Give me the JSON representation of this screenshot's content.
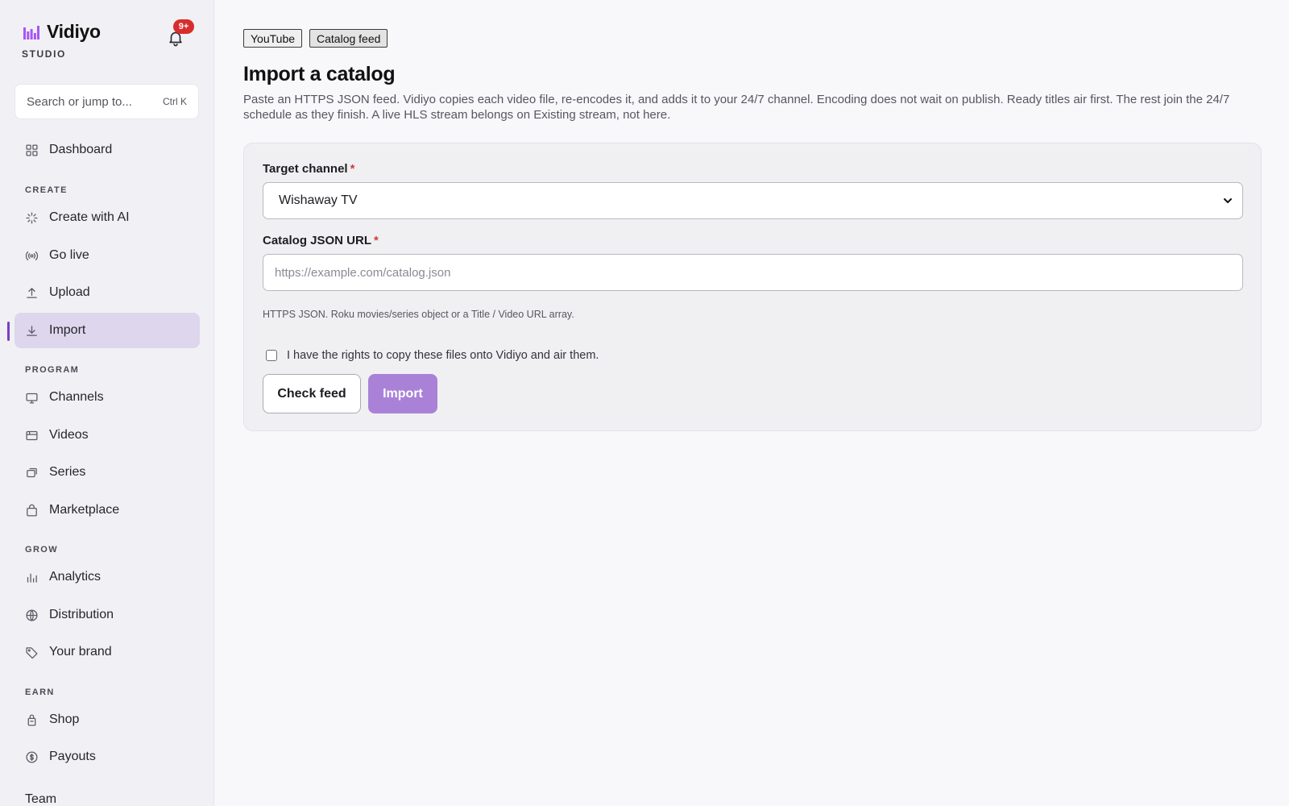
{
  "brand": {
    "name": "Vidiyo",
    "sub": "STUDIO",
    "accent_color": "#a855f7"
  },
  "notifications": {
    "badge": "9+",
    "icon": "bell-icon"
  },
  "search": {
    "placeholder": "Search or jump to...",
    "shortcut": "Ctrl K",
    "icon": "search-icon"
  },
  "sidebar": {
    "dashboard": "Dashboard",
    "sections": {
      "create": "CREATE",
      "program": "PROGRAM",
      "grow": "GROW",
      "earn": "EARN"
    },
    "items": [
      {
        "label": "Create with AI",
        "icon": "sparkle-icon"
      },
      {
        "label": "Go live",
        "icon": "broadcast-icon"
      },
      {
        "label": "Upload",
        "icon": "upload-icon"
      },
      {
        "label": "Import",
        "icon": "download-icon",
        "active": true
      },
      {
        "label": "Channels",
        "icon": "monitor-icon"
      },
      {
        "label": "Videos",
        "icon": "film-icon"
      },
      {
        "label": "Series",
        "icon": "stack-icon"
      },
      {
        "label": "Marketplace",
        "icon": "bag-icon"
      },
      {
        "label": "Analytics",
        "icon": "bar-chart-icon"
      },
      {
        "label": "Distribution",
        "icon": "globe-icon"
      },
      {
        "label": "Your brand",
        "icon": "tag-icon"
      },
      {
        "label": "Shop",
        "icon": "shop-bag-icon"
      },
      {
        "label": "Payouts",
        "icon": "dollar-icon"
      }
    ],
    "team": "Team",
    "active_indicator_color": "#7b3fc4"
  },
  "tabs": [
    {
      "label": "YouTube"
    },
    {
      "label": "Catalog feed",
      "current": true
    }
  ],
  "page": {
    "title": "Import a catalog",
    "description": "Paste an HTTPS JSON feed. Vidiyo copies each video file, re-encodes it, and adds it to your 24/7 channel. Encoding does not wait on publish. Ready titles air first. The rest join the 24/7 schedule as they finish. A live HLS stream belongs on Existing stream, not here."
  },
  "form": {
    "target_channel": {
      "label": "Target channel",
      "required_mark": "*",
      "value": "Wishaway TV"
    },
    "catalog_url": {
      "label": "Catalog JSON URL",
      "required_mark": "*",
      "value": "",
      "placeholder": "https://example.com/catalog.json"
    },
    "hint": "HTTPS JSON. Roku movies/series object or a Title / Video URL array.",
    "rights_checkbox": {
      "label": "I have the rights to copy these files onto Vidiyo and air them.",
      "checked": false
    },
    "check_button": "Check feed",
    "import_button": "Import",
    "import_button_color": "#a982d8"
  }
}
